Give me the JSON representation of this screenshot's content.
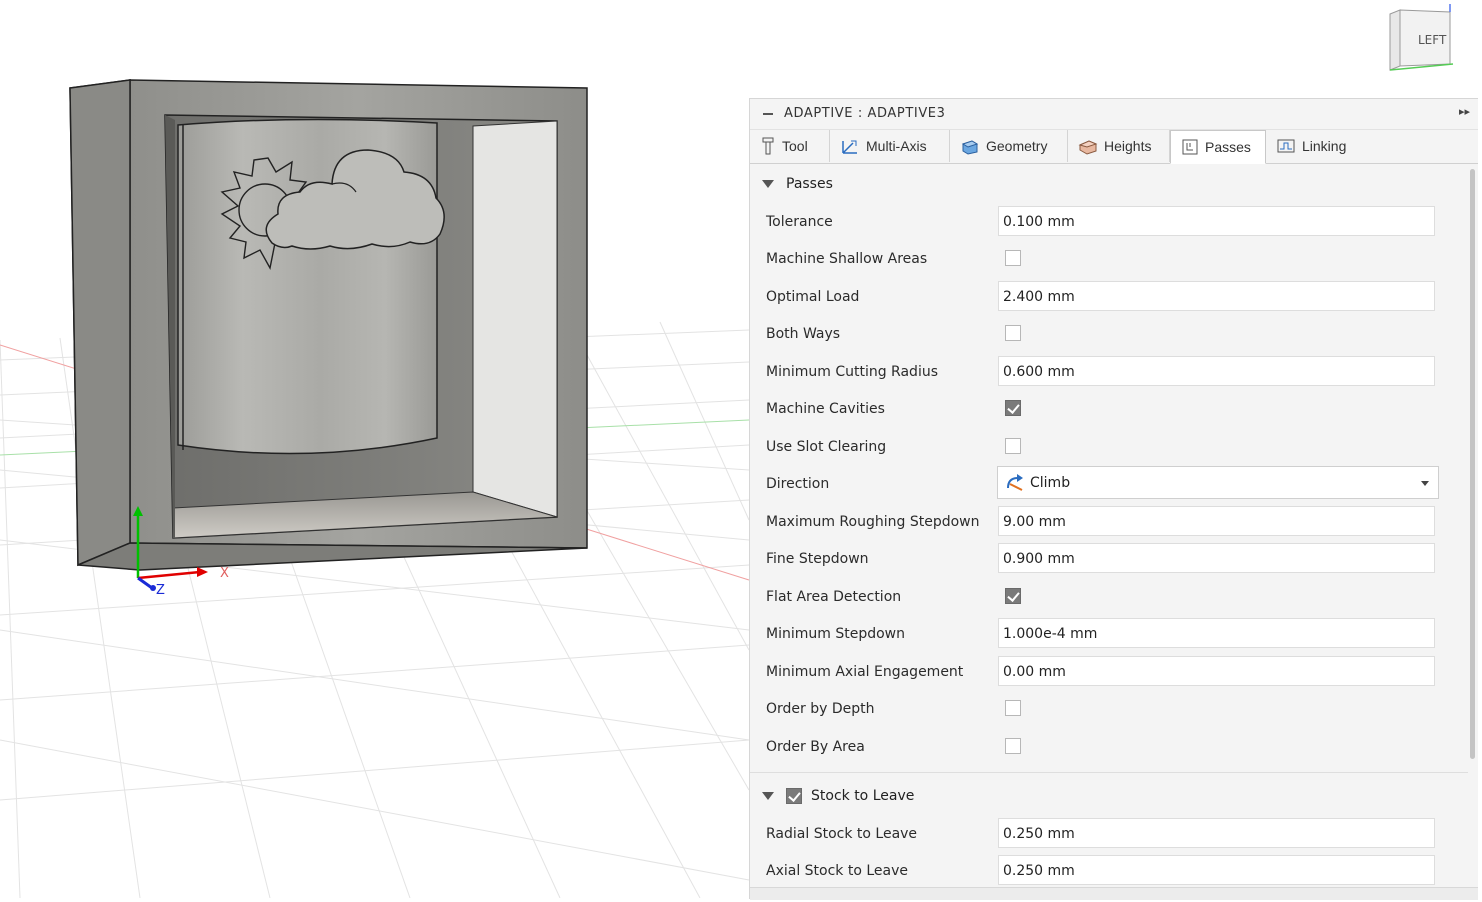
{
  "viewcube": {
    "face_label": "LEFT"
  },
  "axes": {
    "x_label": "X",
    "z_label": "Z"
  },
  "panel": {
    "title": "ADAPTIVE : ADAPTIVE3",
    "tabs": [
      {
        "label": "Tool",
        "icon": "tool-icon"
      },
      {
        "label": "Multi-Axis",
        "icon": "multi-axis-icon"
      },
      {
        "label": "Geometry",
        "icon": "geometry-icon"
      },
      {
        "label": "Heights",
        "icon": "heights-icon"
      },
      {
        "label": "Passes",
        "icon": "passes-icon",
        "active": true
      },
      {
        "label": "Linking",
        "icon": "linking-icon"
      }
    ],
    "passes_section": {
      "title": "Passes",
      "tolerance": {
        "label": "Tolerance",
        "value": "0.100 mm"
      },
      "machine_shallow_areas": {
        "label": "Machine Shallow Areas",
        "checked": false
      },
      "optimal_load": {
        "label": "Optimal Load",
        "value": "2.400 mm"
      },
      "both_ways": {
        "label": "Both Ways",
        "checked": false
      },
      "minimum_cutting_radius": {
        "label": "Minimum Cutting Radius",
        "value": "0.600 mm"
      },
      "machine_cavities": {
        "label": "Machine Cavities",
        "checked": true
      },
      "use_slot_clearing": {
        "label": "Use Slot Clearing",
        "checked": false
      },
      "direction": {
        "label": "Direction",
        "value": "Climb"
      },
      "max_roughing_stepdown": {
        "label": "Maximum Roughing Stepdown",
        "value": "9.00 mm"
      },
      "fine_stepdown": {
        "label": "Fine Stepdown",
        "value": "0.900 mm"
      },
      "flat_area_detection": {
        "label": "Flat Area Detection",
        "checked": true
      },
      "minimum_stepdown": {
        "label": "Minimum Stepdown",
        "value": "1.000e-4 mm"
      },
      "minimum_axial_engagement": {
        "label": "Minimum Axial Engagement",
        "value": "0.00 mm"
      },
      "order_by_depth": {
        "label": "Order by Depth",
        "checked": false
      },
      "order_by_area": {
        "label": "Order By Area",
        "checked": false
      }
    },
    "stock_section": {
      "title": "Stock to Leave",
      "checked": true,
      "radial": {
        "label": "Radial Stock to Leave",
        "value": "0.250 mm"
      },
      "axial": {
        "label": "Axial Stock to Leave",
        "value": "0.250 mm"
      }
    }
  }
}
